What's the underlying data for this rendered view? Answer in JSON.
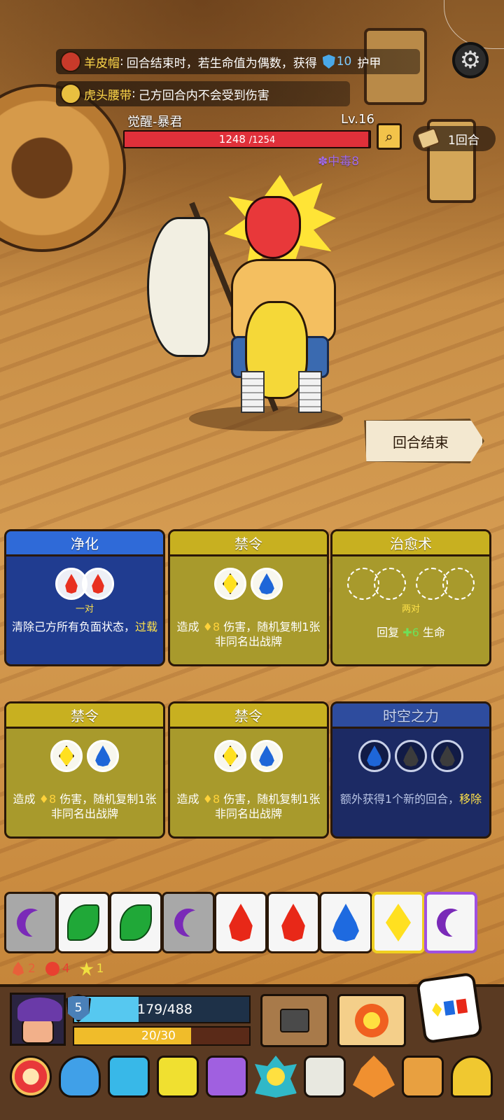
{
  "relics_active": [
    {
      "name": "羊皮帽",
      "sep": ":",
      "desc": "回合结束时，若生命值为偶数，获得",
      "armor_value": "10",
      "armor_label": "护甲",
      "icon": "sheepskin-hat-icon"
    },
    {
      "name": "虎头腰带",
      "sep": ":",
      "desc": "己方回合内不会受到伤害",
      "icon": "tiger-belt-icon"
    }
  ],
  "enemy": {
    "name": "觉醒-暴君",
    "level": "Lv.16",
    "hp_current": "1248",
    "hp_max": "/1254",
    "hp_fraction": 0.995,
    "status": "中毒8"
  },
  "round": {
    "label": "1回合"
  },
  "end_turn": {
    "label": "回合结束"
  },
  "cards": [
    {
      "title": "净化",
      "style": "blue",
      "combo": "一对",
      "desc": "清除己方所有负面状态，",
      "desc_hl": "过载"
    },
    {
      "title": "禁令",
      "style": "yellow",
      "desc_a": "造成 ",
      "gem": "♦8",
      "desc_b": " 伤害，随机复制1张非同名出战牌"
    },
    {
      "title": "治愈术",
      "style": "yellow",
      "combo": "两对",
      "desc_a": "回复 ",
      "heal": "✚6",
      "desc_b": " 生命"
    },
    {
      "title": "禁令",
      "style": "yellow",
      "desc_a": "造成 ",
      "gem": "♦8",
      "desc_b": " 伤害，随机复制1张非同名出战牌"
    },
    {
      "title": "禁令",
      "style": "yellow",
      "desc_a": "造成 ",
      "gem": "♦8",
      "desc_b": " 伤害，随机复制1张非同名出战牌"
    },
    {
      "title": "时空之力",
      "style": "dark",
      "desc": "额外获得1个新的回合，",
      "desc_hl": "移除"
    }
  ],
  "dice": [
    "moon",
    "leaf",
    "leaf",
    "moon",
    "flame",
    "flame",
    "drop",
    "diamond",
    "moon"
  ],
  "counters": {
    "fire": "2",
    "burst": "4",
    "star": "1"
  },
  "player": {
    "shield_level": "5",
    "hp": "179/488",
    "hp_fraction": 0.367,
    "energy": "20/30",
    "energy_fraction": 0.667
  },
  "colors": {
    "hp_red": "#e0303a",
    "hp_blue": "#56c8f0",
    "energy_gold": "#f0bc2a",
    "poison_purple": "#a06ae8"
  }
}
